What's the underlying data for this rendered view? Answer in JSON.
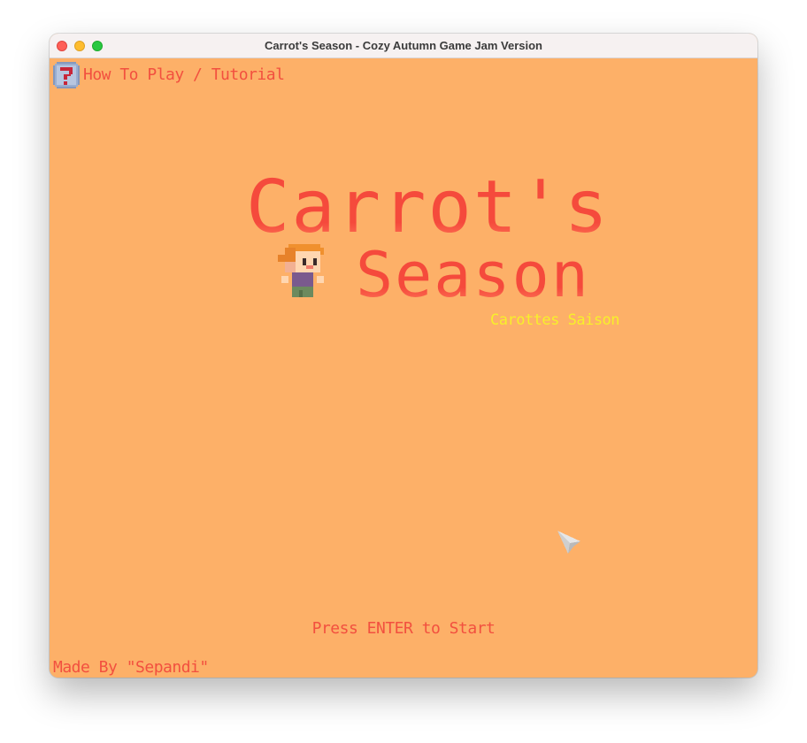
{
  "window": {
    "title": "Carrot's Season - Cozy Autumn Game Jam Version"
  },
  "menu": {
    "help_label": "How To Play / Tutorial",
    "help_icon": "question-mark-icon"
  },
  "title": {
    "line1": "Carrot's",
    "line2": "Season",
    "subtitle": "Carottes Saison"
  },
  "prompt": {
    "start": "Press ENTER to Start"
  },
  "credits": {
    "text": "Made By \"Sepandi\""
  },
  "colors": {
    "background": "#fdb068",
    "title_red": "#f34c3e",
    "subtitle_yellow": "#f7f02a",
    "ui_text": "#f2503f"
  }
}
